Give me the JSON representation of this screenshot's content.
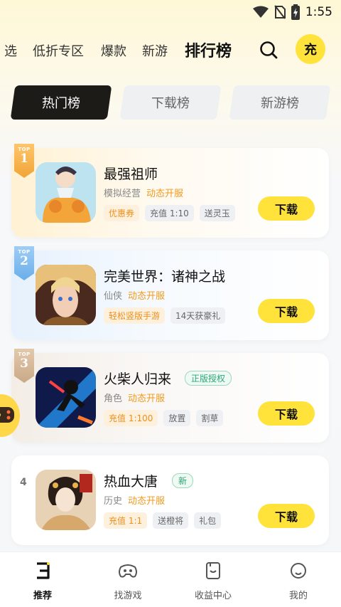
{
  "status_bar": {
    "time": "1:55"
  },
  "top_nav": {
    "tabs": [
      "选",
      "低折专区",
      "爆款",
      "新游",
      "排行榜"
    ],
    "active_index": 4,
    "charge_label": "充"
  },
  "segments": [
    "热门榜",
    "下载榜",
    "新游榜"
  ],
  "active_segment": 0,
  "rank_top_text": "TOP",
  "games": [
    {
      "rank": "1",
      "title": "最强祖师",
      "license": "",
      "genre": "模拟经营",
      "status": "动态开服",
      "tags": [
        {
          "text": "优惠券",
          "hot": true
        },
        {
          "text": "充值 1:10",
          "hot": false
        },
        {
          "text": "送灵玉",
          "hot": false
        }
      ],
      "download": "下载"
    },
    {
      "rank": "2",
      "title": "完美世界：诸神之战",
      "license": "",
      "genre": "仙侠",
      "status": "动态开服",
      "tags": [
        {
          "text": "轻松竖版手游",
          "hot": true
        },
        {
          "text": "14天获豪礼",
          "hot": false
        }
      ],
      "download": "下载"
    },
    {
      "rank": "3",
      "title": "火柴人归来",
      "license": "正版授权",
      "genre": "角色",
      "status": "动态开服",
      "tags": [
        {
          "text": "充值 1:100",
          "hot": true
        },
        {
          "text": "放置",
          "hot": false
        },
        {
          "text": "割草",
          "hot": false
        }
      ],
      "download": "下载"
    },
    {
      "rank": "4",
      "title": "热血大唐",
      "license": "新",
      "genre": "历史",
      "status": "动态开服",
      "tags": [
        {
          "text": "充值 1:1",
          "hot": true
        },
        {
          "text": "送橙将",
          "hot": false
        },
        {
          "text": "礼包",
          "hot": false
        }
      ],
      "download": "下载"
    }
  ],
  "bottom_nav": [
    {
      "label": "推荐",
      "icon": "recommend-icon"
    },
    {
      "label": "找游戏",
      "icon": "gamepad-icon"
    },
    {
      "label": "收益中心",
      "icon": "wallet-icon"
    },
    {
      "label": "我的",
      "icon": "profile-icon"
    }
  ],
  "bottom_active": 0,
  "colors": {
    "accent": "#ffe23a",
    "open_status": "#f19a1c",
    "license": "#2aa774"
  }
}
